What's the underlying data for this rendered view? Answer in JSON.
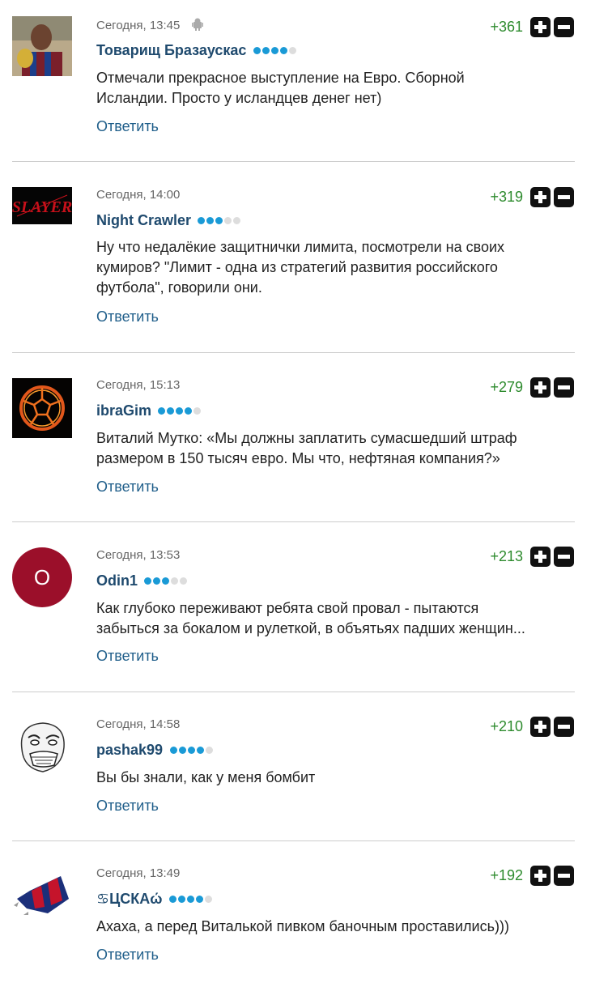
{
  "reply_label": "Ответить",
  "colors": {
    "author": "#1f4a6e",
    "score": "#2e8b2e",
    "reply": "#1f5e8a",
    "dot_on": "#1a9ad6",
    "dot_off": "#dddddd"
  },
  "comments": [
    {
      "time": "Сегодня, 13:45",
      "device_icon": "android-icon",
      "author": "Товарищ Бразаускас",
      "rating_dots": 4,
      "score": "+361",
      "avatar_icon": "footballer-photo-avatar",
      "text_lines": [
        "Отмечали прекрасное выступление на Евро. Сборной",
        "Исландии. Просто у исландцев денег нет)"
      ]
    },
    {
      "time": "Сегодня, 14:00",
      "author": "Night Crawler",
      "rating_dots": 3,
      "score": "+319",
      "avatar_icon": "slayer-logo-avatar",
      "avatar_text": "SLAYER",
      "text_lines": [
        "Ну что недалёкие защитнички лимита, посмотрели на своих",
        "кумиров? \"Лимит - одна из стратегий развития российского",
        "футбола\", говорили они."
      ]
    },
    {
      "time": "Сегодня, 15:13",
      "author": "ibraGim",
      "rating_dots": 4,
      "score": "+279",
      "avatar_icon": "flaming-ball-avatar",
      "text_lines": [
        "Виталий Мутко: «Мы должны заплатить сумасшедший штраф",
        "размером в 150 тысяч евро. Мы что, нефтяная компания?»"
      ]
    },
    {
      "time": "Сегодня, 13:53",
      "author": "Odin1",
      "rating_dots": 3,
      "score": "+213",
      "avatar_icon": "letter-avatar",
      "avatar_text": "O",
      "text_lines": [
        "Как глубоко переживают ребята свой провал - пытаются",
        "забыться за бокалом и рулеткой, в объятьях падших женщин..."
      ]
    },
    {
      "time": "Сегодня, 14:58",
      "author": "pashak99",
      "rating_dots": 4,
      "score": "+210",
      "avatar_icon": "meme-face-avatar",
      "text_lines": [
        "Вы бы знали, как у меня бомбит"
      ]
    },
    {
      "time": "Сегодня, 13:49",
      "author": "♋ЦСКАώ",
      "rating_dots": 4,
      "score": "+192",
      "avatar_icon": "cska-fist-avatar",
      "text_lines": [
        "Ахаха, а перед Виталькой пивком баночным проставились)))"
      ]
    }
  ]
}
